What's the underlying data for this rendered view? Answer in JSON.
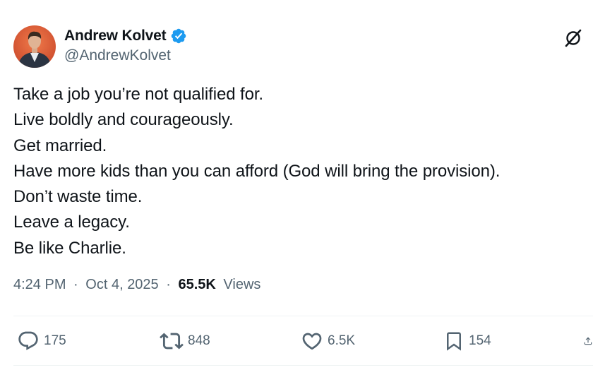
{
  "author": {
    "display_name": "Andrew Kolvet",
    "handle": "@AndrewKolvet",
    "verified_icon": "verified-badge-icon",
    "avatar_icon": "avatar-photo"
  },
  "tweet": {
    "lines": [
      "Take a job you’re not qualified for.",
      "Live boldly and courageously.",
      "Get married.",
      "Have more kids than you can afford (God will bring the provision).",
      "Don’t waste time.",
      "Leave a legacy.",
      "Be like Charlie."
    ],
    "time": "4:24 PM",
    "separator": "·",
    "date": "Oct 4, 2025",
    "views_count": "65.5K",
    "views_label": "Views"
  },
  "actions": {
    "replies": "175",
    "reposts": "848",
    "likes": "6.5K",
    "bookmarks": "154"
  },
  "colors": {
    "text": "#0f1419",
    "muted": "#536471",
    "verified": "#1d9bf0",
    "divider": "#eff3f4"
  }
}
